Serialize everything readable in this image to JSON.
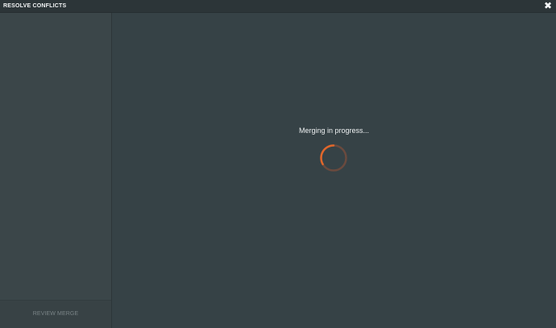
{
  "window": {
    "title": "RESOLVE CONFLICTS",
    "close_glyph": "✖"
  },
  "sidebar": {
    "review_label": "REVIEW MERGE"
  },
  "main": {
    "progress_text": "Merging in progress...",
    "spinner_icon": "spinner-icon",
    "accent_color": "#d9642a"
  }
}
